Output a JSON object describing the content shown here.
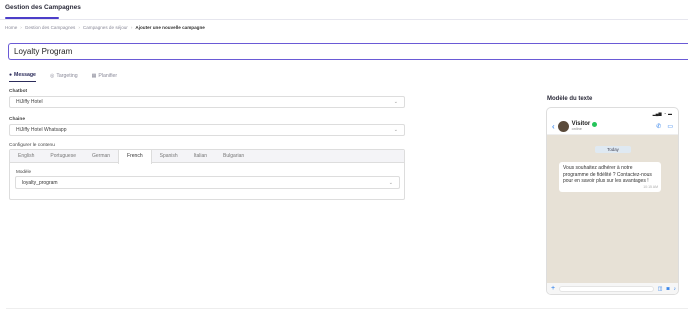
{
  "header": {
    "title": "Gestion des Campagnes"
  },
  "breadcrumb": [
    "Home",
    "Gestion des Campagnes",
    "Campagnes de séjour",
    "Ajouter une nouvelle campagne"
  ],
  "campaign_name": "Loyalty Program",
  "tabs": [
    {
      "label": "Message",
      "icon": "chat-icon"
    },
    {
      "label": "Targeting",
      "icon": "target-icon"
    },
    {
      "label": "Planifier",
      "icon": "calendar-icon"
    }
  ],
  "form": {
    "chatbot_label": "Chatbot",
    "chatbot_value": "HiJiffy Hotel",
    "chaine_label": "Chaine",
    "chaine_value": "HiJiffy Hotel Whatsapp",
    "configure_label": "Configurer le contenu",
    "languages": [
      "English",
      "Portuguese",
      "German",
      "French",
      "Spanish",
      "Italian",
      "Bulgarian"
    ],
    "active_language": "French",
    "modele_label": "Modèle",
    "modele_value": "loyalty_program"
  },
  "preview": {
    "title": "Modèle du texte",
    "contact_name": "Visitor",
    "contact_status": "online",
    "day_label": "Today",
    "message": "Vous souhaitez adhérer à notre programme de fidélité ? Contactez-nous pour en savoir plus sur les avantages !",
    "message_time": "10:15 AM"
  },
  "colors": {
    "accent": "#4c3ec9",
    "chat_bg": "#e7e1d6",
    "link_blue": "#1a73e8"
  }
}
